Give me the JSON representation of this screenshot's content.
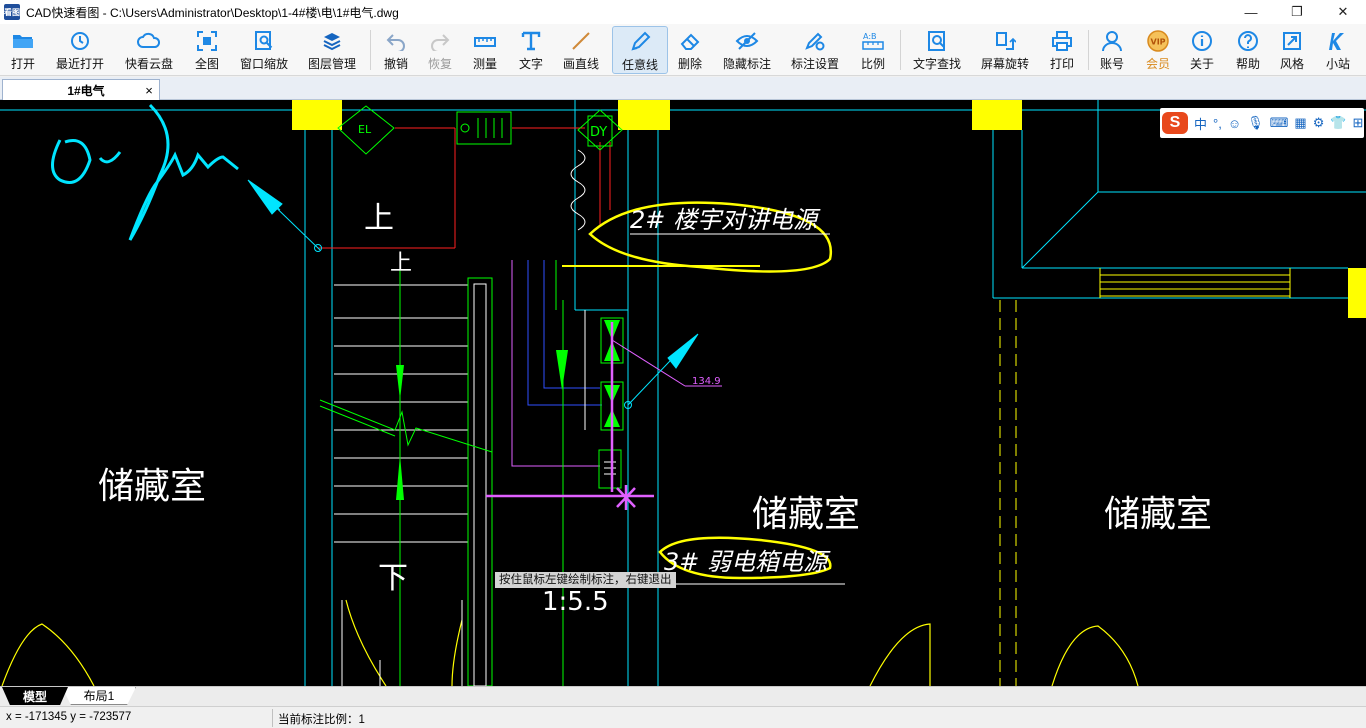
{
  "window": {
    "app_icon_text": "看图",
    "title": "CAD快速看图 - C:\\Users\\Administrator\\Desktop\\1-4#楼\\电\\1#电气.dwg",
    "minimize": "—",
    "restore": "❐",
    "close": "✕"
  },
  "toolbar": {
    "items": [
      {
        "label": "打开",
        "icon": "folder-icon"
      },
      {
        "label": "最近打开",
        "icon": "history-icon"
      },
      {
        "label": "快看云盘",
        "icon": "cloud-icon"
      },
      {
        "label": "全图",
        "icon": "fit-all-icon"
      },
      {
        "label": "窗口缩放",
        "icon": "window-zoom-icon"
      },
      {
        "label": "图层管理",
        "icon": "layers-icon"
      },
      {
        "label": "撤销",
        "icon": "undo-icon"
      },
      {
        "label": "恢复",
        "icon": "redo-icon",
        "state": "disabled"
      },
      {
        "label": "测量",
        "icon": "measure-icon"
      },
      {
        "label": "文字",
        "icon": "text-icon"
      },
      {
        "label": "画直线",
        "icon": "line-icon"
      },
      {
        "label": "任意线",
        "icon": "pen-icon",
        "state": "active"
      },
      {
        "label": "删除",
        "icon": "eraser-icon"
      },
      {
        "label": "隐藏标注",
        "icon": "hide-eye-icon"
      },
      {
        "label": "标注设置",
        "icon": "annotation-settings-icon"
      },
      {
        "label": "比例",
        "icon": "scale-icon"
      },
      {
        "label": "文字查找",
        "icon": "text-search-icon"
      },
      {
        "label": "屏幕旋转",
        "icon": "rotate-screen-icon"
      },
      {
        "label": "打印",
        "icon": "printer-icon"
      },
      {
        "label": "账号",
        "icon": "user-icon"
      },
      {
        "label": "会员",
        "icon": "vip-icon",
        "state": "vip"
      },
      {
        "label": "关于",
        "icon": "info-icon"
      },
      {
        "label": "帮助",
        "icon": "help-icon"
      },
      {
        "label": "风格",
        "icon": "style-icon"
      },
      {
        "label": "小站",
        "icon": "site-icon"
      }
    ]
  },
  "tabs": {
    "document": "1#电气",
    "close_glyph": "×"
  },
  "drawing": {
    "room_labels": [
      "储藏室",
      "储藏室",
      "储藏室"
    ],
    "up_labels": [
      "上",
      "上"
    ],
    "down_label": "下",
    "equipment_labels": {
      "el": "EL",
      "dy": "DY"
    },
    "annotation_1": "2# 楼宇对讲电源",
    "annotation_2": "3# 弱电箱电源",
    "dimension_value": "134.9",
    "scale_text": "1:5.5",
    "hint": "按住鼠标左键绘制标注，右键退出",
    "colors": {
      "background": "#000000",
      "cyan": "#00e5ff",
      "yellow": "#ffff00",
      "green": "#00ff00",
      "red": "#ff2020",
      "magenta": "#e060ff",
      "white": "#ffffff"
    }
  },
  "ime": {
    "brand": "S",
    "mode": "中",
    "punct": "°,"
  },
  "sheet_tabs": [
    "模型",
    "布局1"
  ],
  "status": {
    "coords": "x = -171345  y = -723577",
    "scale_label": "当前标注比例：1"
  }
}
